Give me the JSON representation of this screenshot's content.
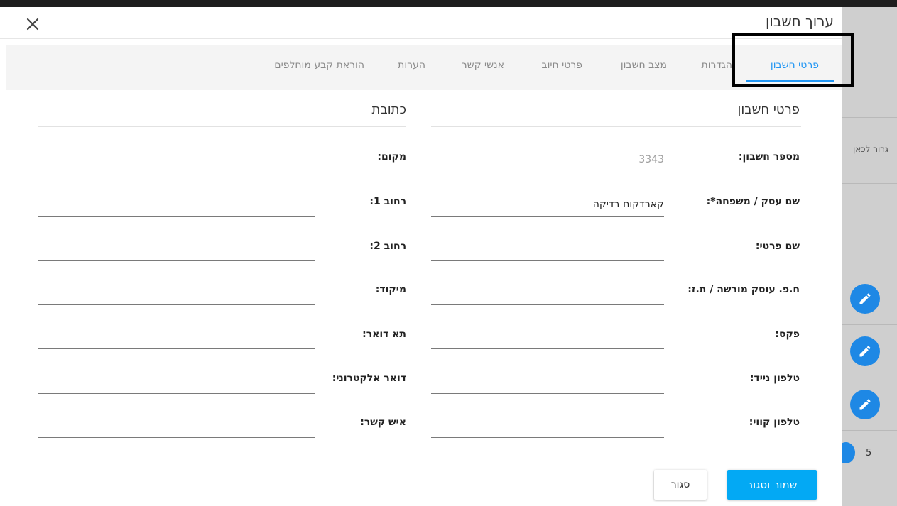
{
  "dialog": {
    "title": "ערוך חשבון",
    "close_icon": "close-icon"
  },
  "tabs": [
    {
      "label": "פרטי חשבון",
      "active": true
    },
    {
      "label": "הגדרות",
      "active": false
    },
    {
      "label": "מצב חשבון",
      "active": false
    },
    {
      "label": "פרטי חיוב",
      "active": false
    },
    {
      "label": "אנשי קשר",
      "active": false
    },
    {
      "label": "הערות",
      "active": false
    },
    {
      "label": "הוראת קבע מוחלפים",
      "active": false
    }
  ],
  "account_section": {
    "title": "פרטי חשבון",
    "fields": [
      {
        "label": "מספר חשבון:",
        "value": "3343",
        "disabled": true
      },
      {
        "label": "שם עסק / משפחה*:",
        "value": "קארדקום בדיקה"
      },
      {
        "label": "שם פרטי:",
        "value": ""
      },
      {
        "label": "ח.פ. עוסק מורשה / ת.ז:",
        "value": ""
      },
      {
        "label": "פקס:",
        "value": ""
      },
      {
        "label": "טלפון נייד:",
        "value": ""
      },
      {
        "label": "טלפון קווי:",
        "value": ""
      }
    ]
  },
  "address_section": {
    "title": "כתובת",
    "fields": [
      {
        "label": "מקום:",
        "value": ""
      },
      {
        "label": "רחוב 1:",
        "value": ""
      },
      {
        "label": "רחוב 2:",
        "value": ""
      },
      {
        "label": "מיקוד:",
        "value": ""
      },
      {
        "label": "תא דואר:",
        "value": ""
      },
      {
        "label": "דואר אלקטרוני:",
        "value": ""
      },
      {
        "label": "איש קשר:",
        "value": ""
      }
    ]
  },
  "buttons": {
    "save_close": "שמור וסגור",
    "close": "סגור"
  },
  "background": {
    "side_text": "גרור לכאן",
    "page_number": "5",
    "edit_icon": "pencil-icon"
  },
  "colors": {
    "accent": "#2196f3",
    "save_button": "#03a9f4",
    "edit_fab": "#1e88e5"
  }
}
